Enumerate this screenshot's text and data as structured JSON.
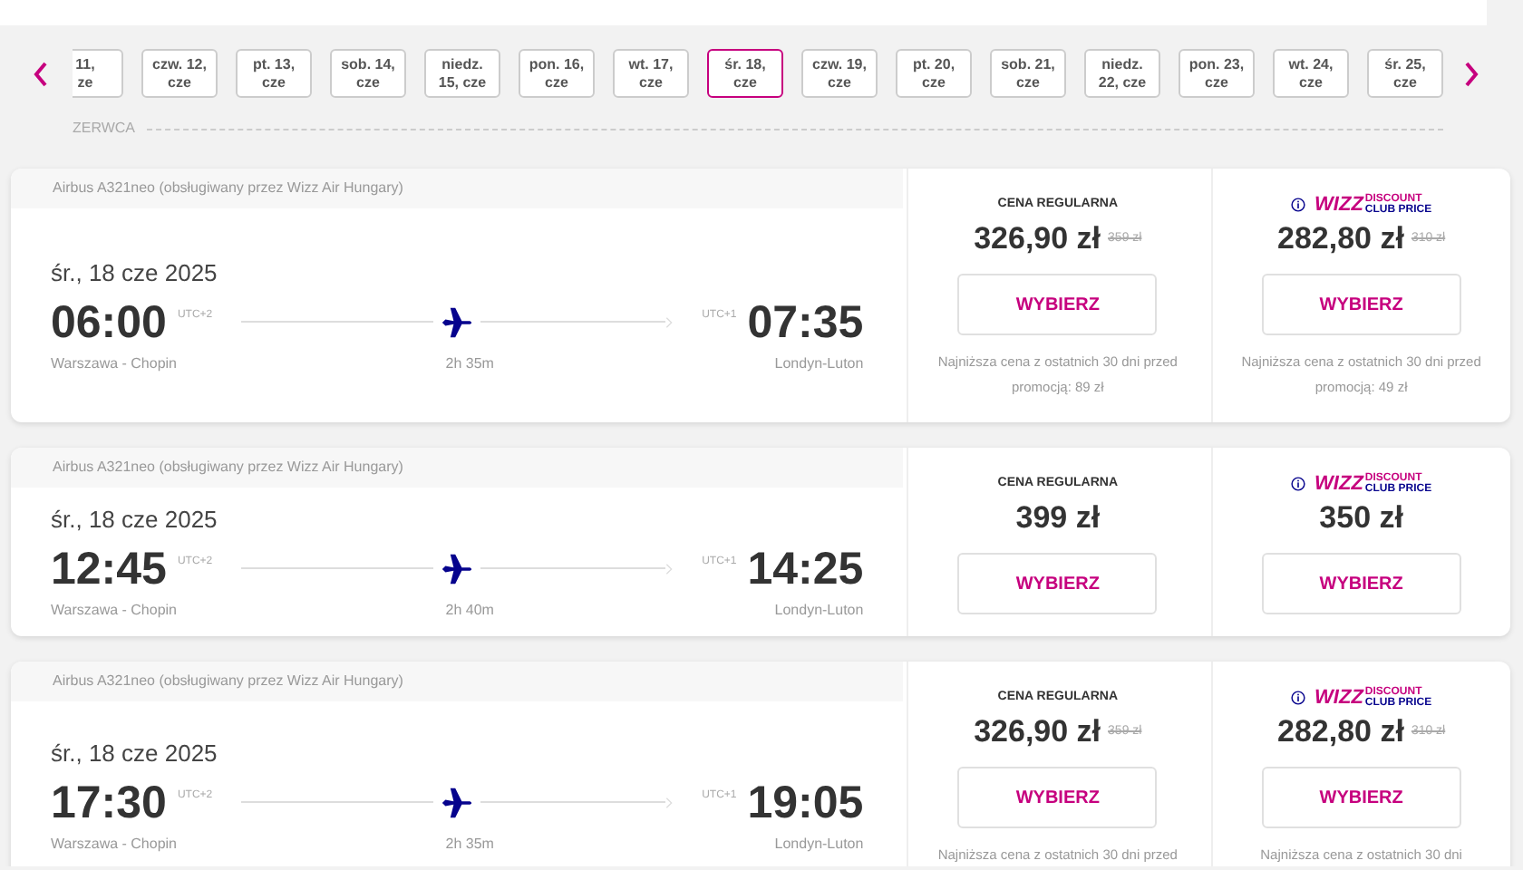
{
  "dates": [
    {
      "label": "11,\nze",
      "selected": false
    },
    {
      "label": "czw. 12,\ncze",
      "selected": false
    },
    {
      "label": "pt. 13,\ncze",
      "selected": false
    },
    {
      "label": "sob. 14,\ncze",
      "selected": false
    },
    {
      "label": "niedz.\n15, cze",
      "selected": false
    },
    {
      "label": "pon. 16,\ncze",
      "selected": false
    },
    {
      "label": "wt. 17,\ncze",
      "selected": false
    },
    {
      "label": "śr. 18,\ncze",
      "selected": true
    },
    {
      "label": "czw. 19,\ncze",
      "selected": false
    },
    {
      "label": "pt. 20,\ncze",
      "selected": false
    },
    {
      "label": "sob. 21,\ncze",
      "selected": false
    },
    {
      "label": "niedz.\n22, cze",
      "selected": false
    },
    {
      "label": "pon. 23,\ncze",
      "selected": false
    },
    {
      "label": "wt. 24,\ncze",
      "selected": false
    },
    {
      "label": "śr. 25,\ncze",
      "selected": false
    }
  ],
  "month_label": "ZERWCA",
  "flights": [
    {
      "aircraft": "Airbus A321neo (obsługiwany przez Wizz Air Hungary)",
      "date": "śr., 18 cze 2025",
      "departure": {
        "time": "06:00",
        "utc": "UTC+2",
        "airport": "Warszawa - Chopin"
      },
      "duration": "2h 35m",
      "arrival": {
        "time": "07:35",
        "utc": "UTC+1",
        "airport": "Londyn-Luton"
      },
      "fares": [
        {
          "kind": "regular",
          "label": "CENA REGULARNA",
          "price": "326,90 zł",
          "old_price": "359 zł",
          "button": "WYBIERZ",
          "note": "Najniższa cena z ostatnich 30 dni przed promocją: 89 zł"
        },
        {
          "kind": "club",
          "brand": "WIZZ",
          "brand_top": "DISCOUNT",
          "brand_bottom": "CLUB PRICE",
          "price": "282,80 zł",
          "old_price": "310 zł",
          "button": "WYBIERZ",
          "note": "Najniższa cena z ostatnich 30 dni przed promocją: 49 zł"
        }
      ]
    },
    {
      "aircraft": "Airbus A321neo (obsługiwany przez Wizz Air Hungary)",
      "date": "śr., 18 cze 2025",
      "departure": {
        "time": "12:45",
        "utc": "UTC+2",
        "airport": "Warszawa - Chopin"
      },
      "duration": "2h 40m",
      "arrival": {
        "time": "14:25",
        "utc": "UTC+1",
        "airport": "Londyn-Luton"
      },
      "fares": [
        {
          "kind": "regular",
          "label": "CENA REGULARNA",
          "price": "399 zł",
          "button": "WYBIERZ"
        },
        {
          "kind": "club",
          "brand": "WIZZ",
          "brand_top": "DISCOUNT",
          "brand_bottom": "CLUB PRICE",
          "price": "350 zł",
          "button": "WYBIERZ"
        }
      ]
    },
    {
      "aircraft": "Airbus A321neo (obsługiwany przez Wizz Air Hungary)",
      "date": "śr., 18 cze 2025",
      "departure": {
        "time": "17:30",
        "utc": "UTC+2",
        "airport": "Warszawa - Chopin"
      },
      "duration": "2h 35m",
      "arrival": {
        "time": "19:05",
        "utc": "UTC+1",
        "airport": "Londyn-Luton"
      },
      "fares": [
        {
          "kind": "regular",
          "label": "CENA REGULARNA",
          "price": "326,90 zł",
          "old_price": "359 zł",
          "button": "WYBIERZ",
          "note": "Najniższa cena z ostatnich 30 dni przed"
        },
        {
          "kind": "club",
          "brand": "WIZZ",
          "brand_top": "DISCOUNT",
          "brand_bottom": "CLUB PRICE",
          "price": "282,80 zł",
          "old_price": "310 zł",
          "button": "WYBIERZ",
          "note": "Najniższa cena z ostatnich 30 dni"
        }
      ]
    }
  ]
}
